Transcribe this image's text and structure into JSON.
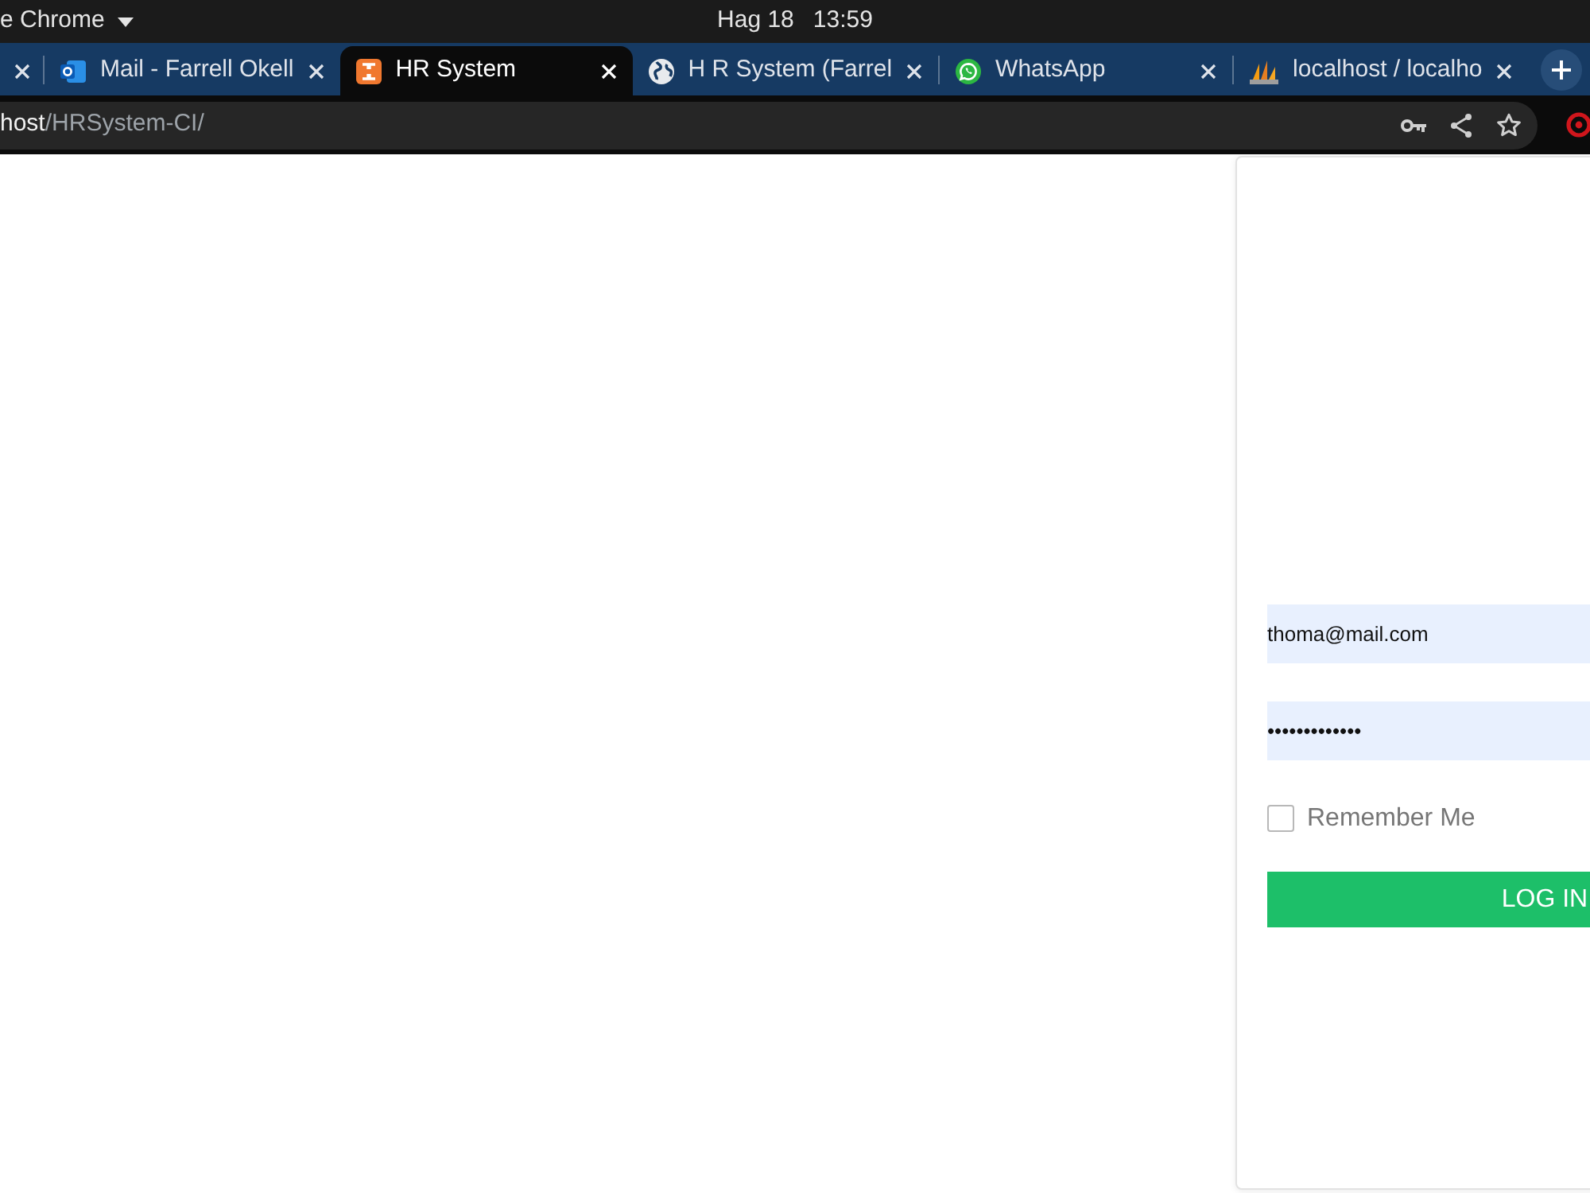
{
  "system_bar": {
    "app_menu": "e Chrome",
    "date": "Hag 18",
    "time": "13:59"
  },
  "tabs": [
    {
      "selected": false
    },
    {
      "title": "Mail - Farrell Okell",
      "kind": "mail",
      "selected": false
    },
    {
      "title": "HR System",
      "kind": "logo",
      "selected": true
    },
    {
      "title": "H R System (Farrel",
      "kind": "globe",
      "selected": false
    },
    {
      "title": "WhatsApp",
      "kind": "chat",
      "selected": false
    },
    {
      "title": "localhost / localho",
      "kind": "sails",
      "selected": false
    }
  ],
  "address_bar": {
    "host": "host",
    "path": "/HRSystem-CI/"
  },
  "login": {
    "email": {
      "value": "thoma@mail.com"
    },
    "password": {
      "value": "•••••••••••••"
    },
    "remember_me": {
      "label": "Remember Me",
      "checked": false
    },
    "submit": "LOG IN"
  }
}
